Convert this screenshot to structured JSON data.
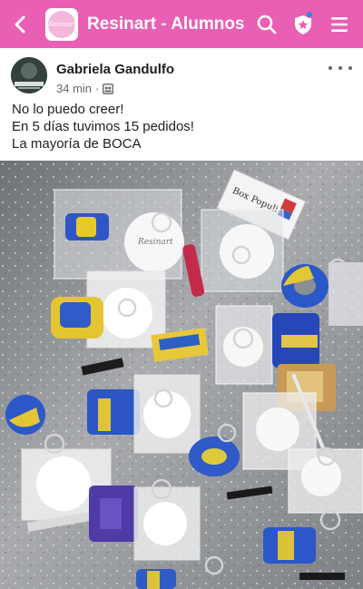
{
  "topbar": {
    "group_name": "Resinart - Alumnos",
    "logo_text": "Resinart",
    "icons": [
      "back-arrow-icon",
      "search-icon",
      "shield-star-icon",
      "menu-icon"
    ],
    "color": "#e95fb4",
    "notification_dot_color": "#2b8ad8"
  },
  "post": {
    "author": "Gabriela Gandulfo",
    "time": "34 min",
    "separator": "·",
    "audience_icon": "group-audience-icon",
    "text_lines": [
      "No lo puedo creer!",
      "En 5 días tuvimos 15 pedidos!",
      "La mayoría de BOCA"
    ],
    "photo_labels": {
      "box_brand": "Box Populi",
      "card_script": "Resinart"
    }
  }
}
